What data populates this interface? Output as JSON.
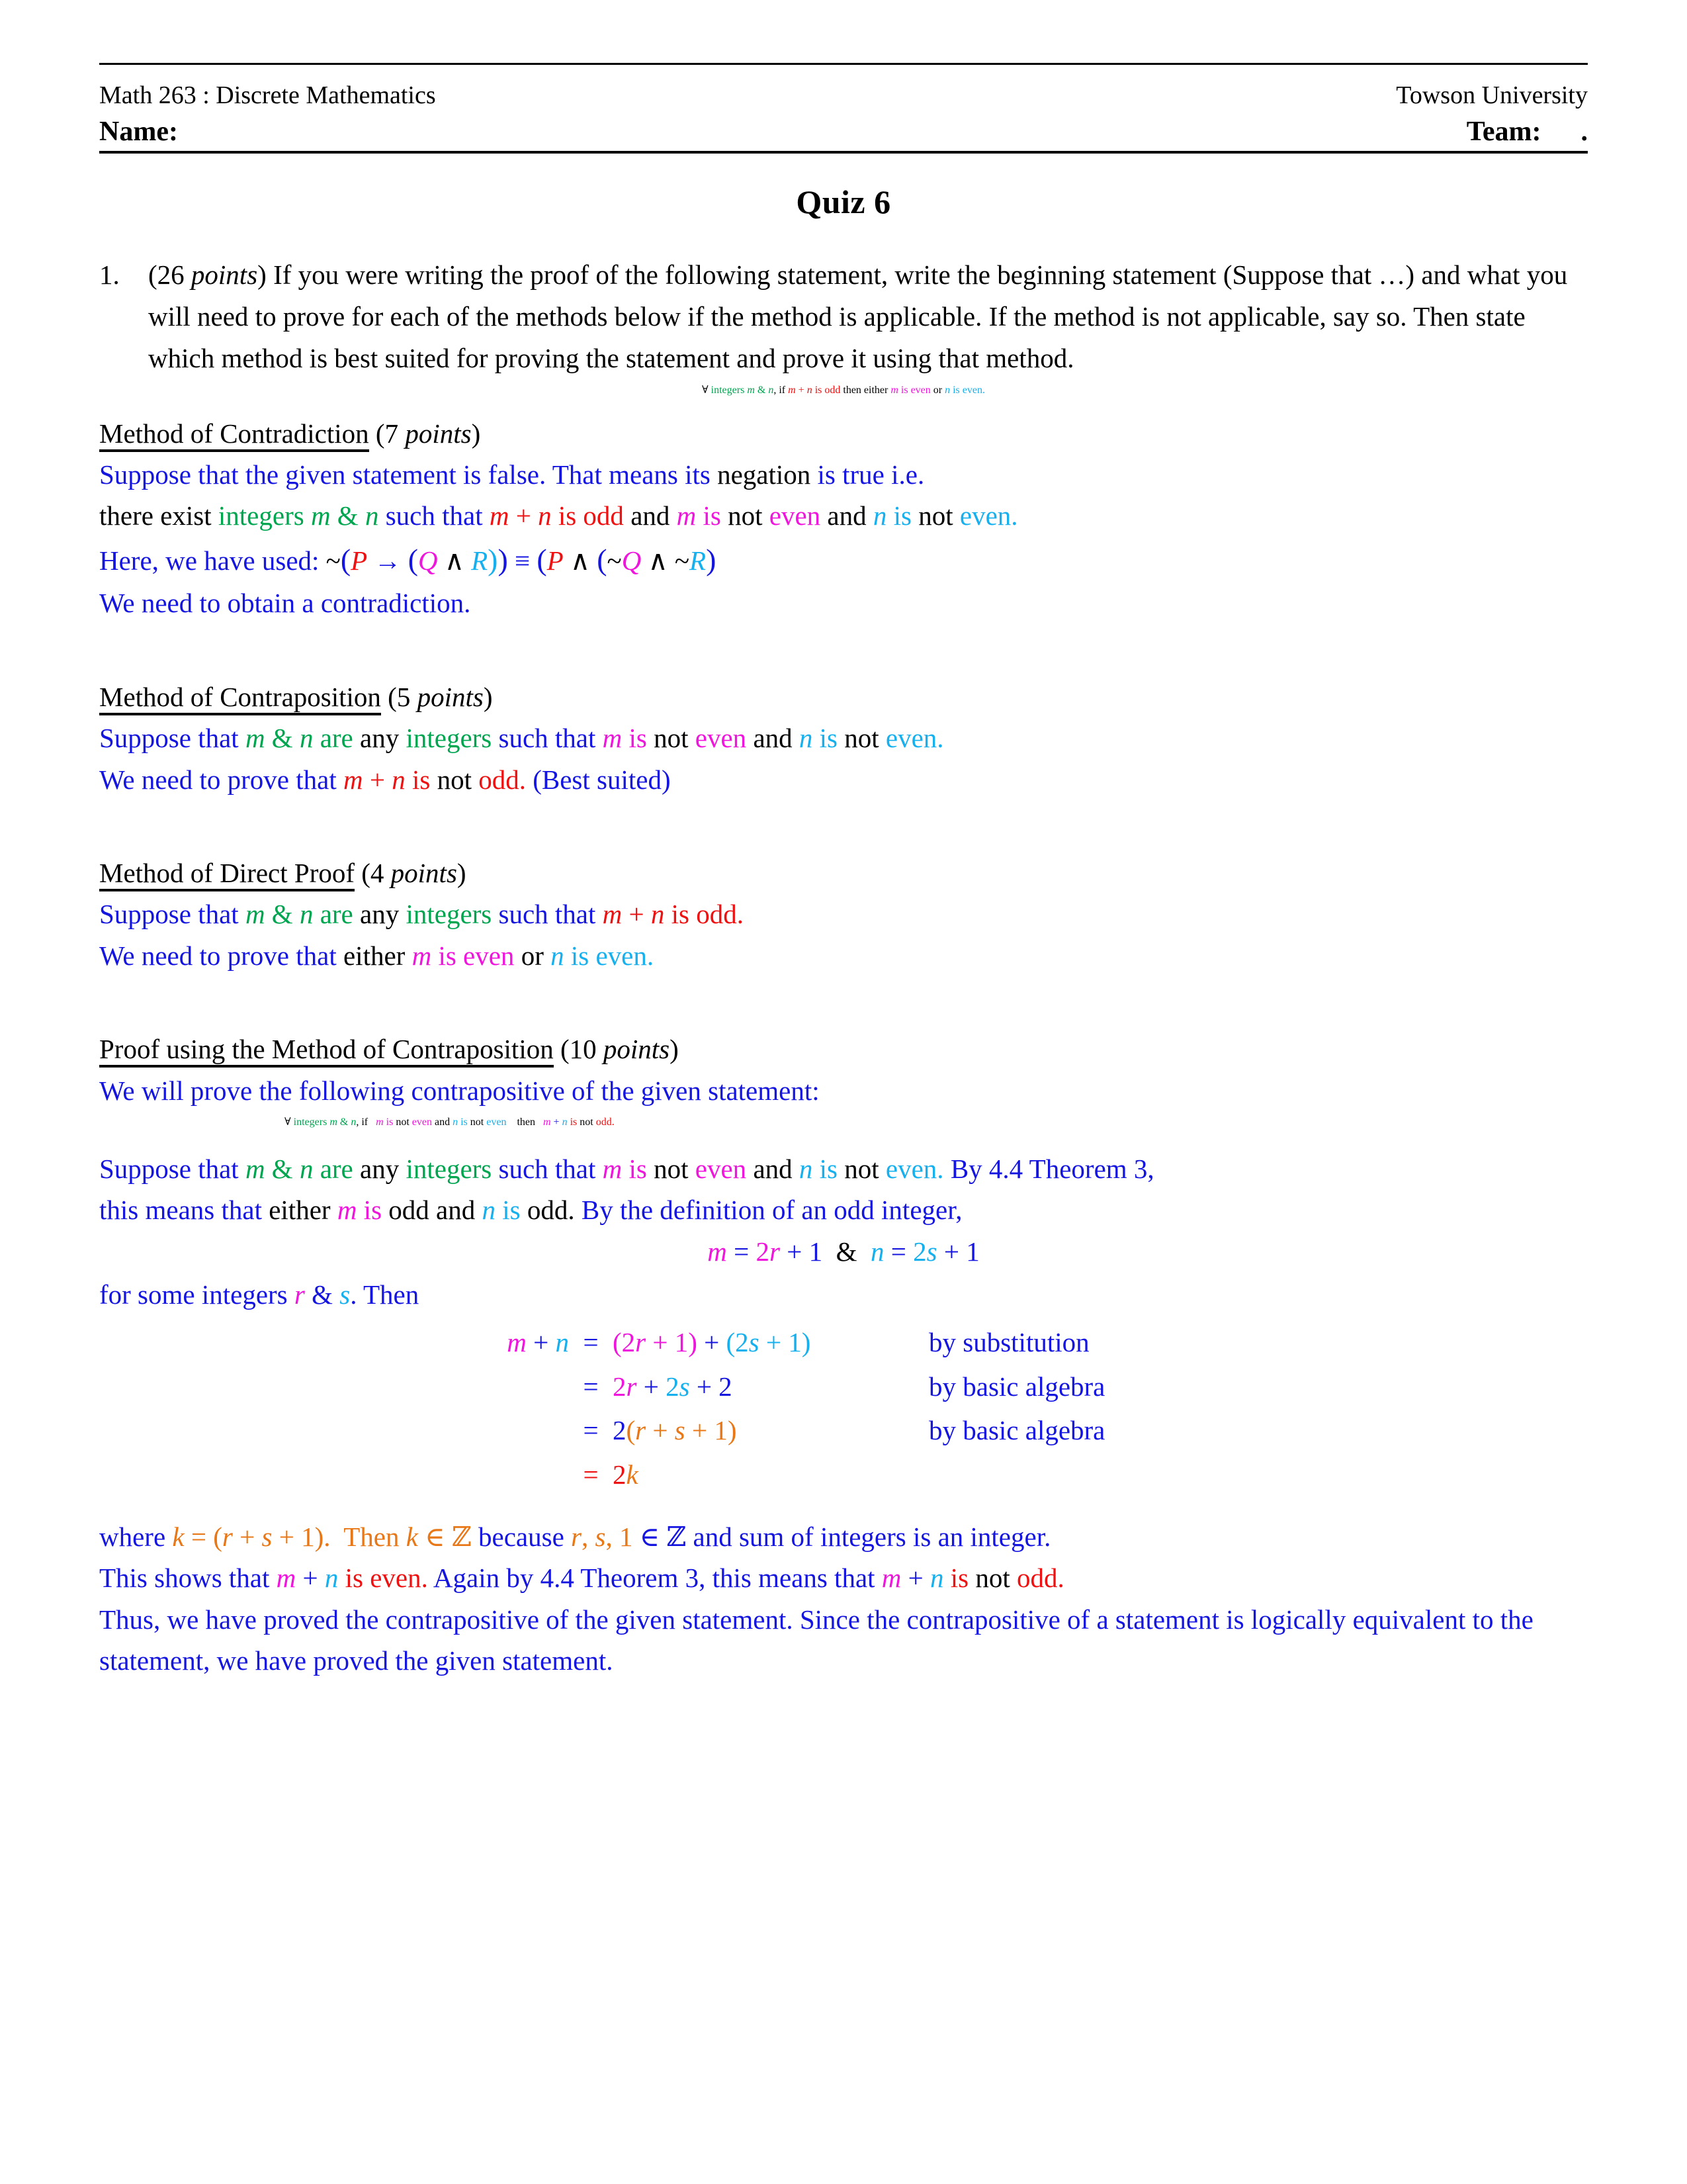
{
  "colors": {
    "blue": "#1515E0",
    "red": "#EE1111",
    "green": "#00A550",
    "magenta": "#F015DC",
    "cyan": "#16B0EE",
    "orange": "#E87817",
    "black": "#000000"
  },
  "header": {
    "course": "Math 263 : Discrete Mathematics",
    "university": "Towson University",
    "name_label": "Name:",
    "team_label": "Team:",
    "team_dot": ".",
    "title": "Quiz 6"
  },
  "problem": {
    "number": "1.",
    "points": "(26 points)",
    "points_value": "26",
    "points_word": "points",
    "body": "If you were writing the proof of the following statement, write the beginning statement (Suppose that …) and what you will need to prove for each of the methods below if the method is applicable. If the method is not applicable, say so.  Then state which method is best suited for proving the statement and prove it using that method.",
    "statement": {
      "forall": "∀",
      "integers": "integers",
      "m_and_n": "m & n",
      "comma_if": ", if",
      "m_plus_n_is_odd": "m + n is odd",
      "then_either": "then either",
      "m_is_even": "m is even",
      "or": "or",
      "n_is_even": "n is even."
    }
  },
  "sections": [
    {
      "id": "contradiction",
      "heading_underlined": "Method of Contradiction",
      "heading_points": "(7 points)",
      "points": "7",
      "points_word": "points",
      "lines": [
        "Suppose that the given statement is false. That means its negation is true i.e.",
        "there exist integers m & n such that m + n is odd and m is not even and n is not even.",
        "Here, we have used: ~(P → (Q ∧ R)) ≡ (P ∧ (~Q ∧ ~R)",
        "We need to obtain a contradiction."
      ],
      "logic": {
        "prefix": "Here, we have used:",
        "tilde": "~",
        "P": "P",
        "arrow": "→",
        "Q": "Q",
        "wedge": "∧",
        "R": "R",
        "equiv": "≡"
      }
    },
    {
      "id": "contraposition",
      "heading_underlined": "Method of Contraposition",
      "heading_points": "(5 points)",
      "points": "5",
      "points_word": "points",
      "lines": [
        "Suppose that m & n are any integers such that m is not even and n is not even.",
        "We need to prove that m + n is not odd. (Best suited)"
      ],
      "best_suited": "(Best suited)"
    },
    {
      "id": "direct-proof",
      "heading_underlined": "Method of Direct Proof",
      "heading_points": "(4 points)",
      "points": "4",
      "points_word": "points",
      "lines": [
        "Suppose that m & n are any integers such that m + n is odd.",
        "We need to prove that either m is even or n is even."
      ]
    },
    {
      "id": "proof",
      "heading_underlined": "Proof using the Method of Contraposition",
      "heading_points": "(10 points)",
      "points": "10",
      "points_word": "points",
      "lines": [
        "We will prove the following contrapositive of the given statement:",
        "∀ integers m & n, if   m is not even and n is not even    then    m + n is not odd.",
        "Suppose that m & n are any integers such that m is not even and n is not even. By 4.4 Theorem 3, this means that either m is odd and n is odd. By the definition of an odd integer,",
        "m = 2r + 1  &  n = 2s + 1",
        "for some integers r & s. Then",
        "where k = (r + s + 1).  Then k ∈ ℤ because r, s, 1 ∈ ℤ and sum of integers is an integer.",
        "This shows that m + n is even. Again by 4.4 Theorem 3, this means that m + n is not odd.",
        "Thus, we have proved the contrapositive of the given statement. Since the contrapositive of a statement is logically equivalent to the statement, we have proved the given statement."
      ]
    }
  ],
  "text": {
    "suppose_that": "Suppose that",
    "are": "are",
    "any": "any",
    "integers": "integers",
    "such_that": "such that",
    "is": "is",
    "not": "not",
    "and": "and",
    "even": "even",
    "odd": "odd.",
    "m": "m",
    "n": "n",
    "amp": "&",
    "plus": "+",
    "we_need_to_prove_that": "We need to prove that",
    "we_need_to_obtain": "We need to obtain a contradiction.",
    "either": "either",
    "or": "or",
    "then": "then",
    "if": "if",
    "forall": "∀",
    "period": ".",
    "comma": ","
  },
  "derivation": {
    "title_intro": "for some integers r & s. Then",
    "defn_line": {
      "m": "m",
      "eq": "=",
      "m_rhs": "2r + 1",
      "amp": "&",
      "n": "n",
      "n_rhs": "2s + 1"
    },
    "rows": [
      {
        "lhs": "m + n",
        "eq": "=",
        "rhs": "(2r + 1) + (2s + 1)",
        "reason": "by substitution"
      },
      {
        "lhs": "",
        "eq": "=",
        "rhs": "2r + 2s + 2",
        "reason": "by basic algebra"
      },
      {
        "lhs": "",
        "eq": "=",
        "rhs": "2(r + s + 1)",
        "reason": "by basic algebra"
      },
      {
        "lhs": "",
        "eq": "=",
        "rhs": "2k",
        "reason": ""
      }
    ]
  },
  "closing": {
    "where": "where",
    "k": "k",
    "k_def": "= (r + s + 1).",
    "then": "Then",
    "k_in_Z": "k ∈ ℤ",
    "because": "because",
    "rs1_in_Z": "r, s, 1 ∈ ℤ",
    "and_sum": "and sum of integers is an integer.",
    "this_shows": "This shows that",
    "is_even": "is even.",
    "again_by": "Again by 4.4 Theorem 3, this means that",
    "is_not": "is",
    "not": "not",
    "odd": "odd.",
    "thus": "Thus, we have proved the contrapositive of the given statement. Since the contrapositive of a statement is logically equivalent to the statement, we have proved the given statement.",
    "by_thm": "By 4.4 Theorem 3,",
    "this_means_either": "this means that either",
    "is_odd": "is odd",
    "and": "and",
    "is_odd2": "is odd.",
    "by_defn": "By the definition of an odd integer,",
    "for_some_integers": "for some integers",
    "r": "r",
    "s": "s",
    "then_word": ". Then"
  }
}
